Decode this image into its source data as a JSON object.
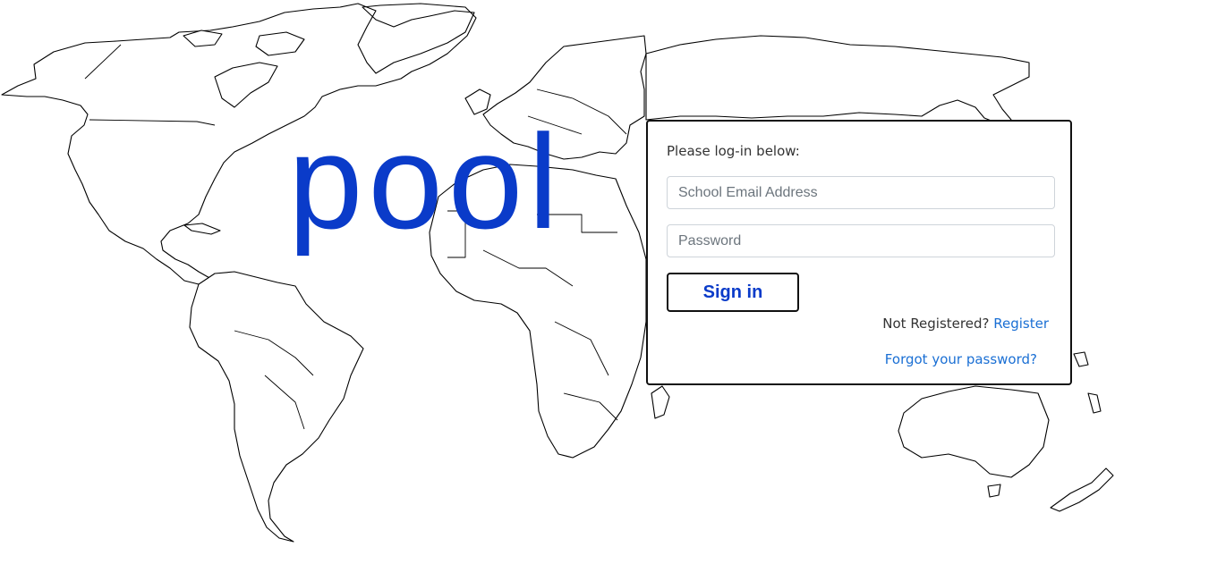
{
  "logo": {
    "text": "pool",
    "color": "#0a3bc9"
  },
  "background": {
    "icon": "world-map-outline"
  },
  "login": {
    "prompt": "Please log-in below:",
    "email_placeholder": "School Email Address",
    "email_value": "",
    "password_placeholder": "Password",
    "password_value": "",
    "signin_label": "Sign in",
    "not_registered_text": "Not Registered?",
    "register_link": "Register",
    "forgot_link": "Forgot your password?"
  },
  "colors": {
    "brand": "#0a3bc9",
    "link": "#1a6fd4"
  }
}
